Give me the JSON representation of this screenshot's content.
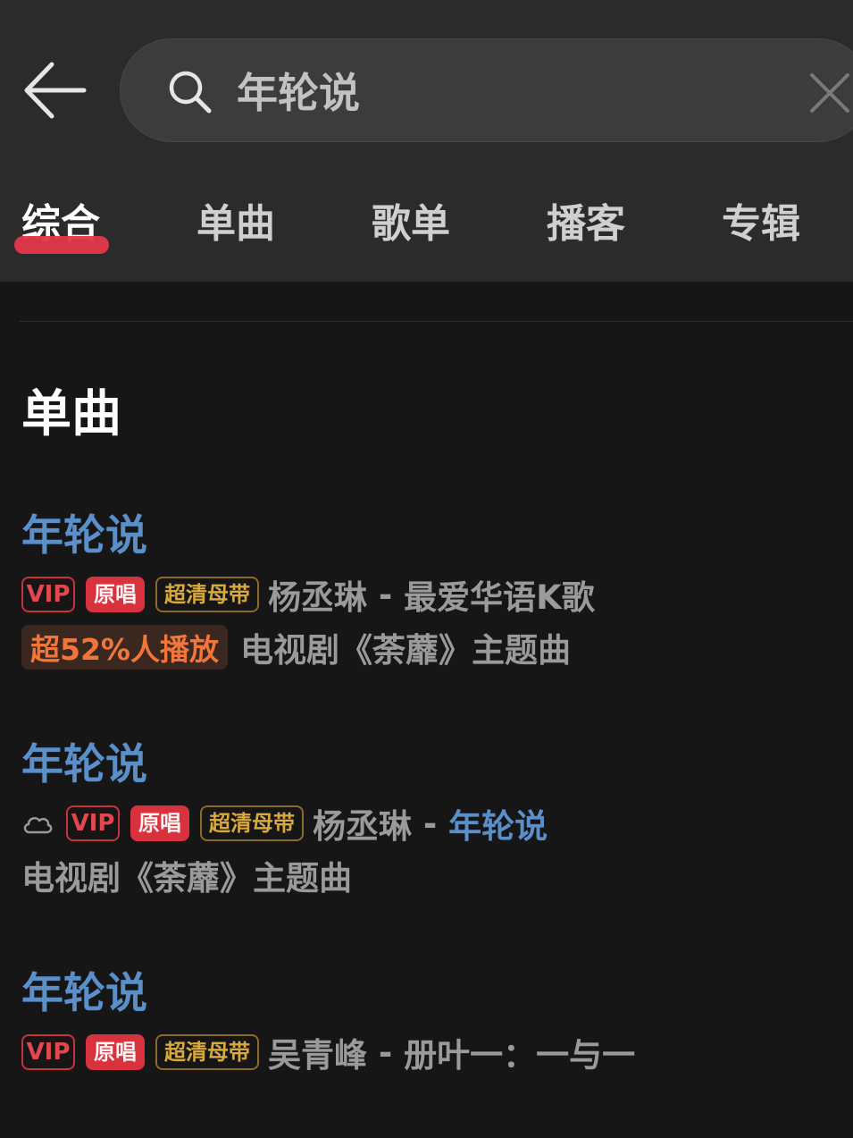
{
  "search": {
    "query": "年轮说"
  },
  "tabs": [
    {
      "label": "综合",
      "active": true
    },
    {
      "label": "单曲",
      "active": false
    },
    {
      "label": "歌单",
      "active": false
    },
    {
      "label": "播客",
      "active": false
    },
    {
      "label": "专辑",
      "active": false
    }
  ],
  "section": {
    "title": "单曲"
  },
  "songs": [
    {
      "title": "年轮说",
      "badges": {
        "vip": "VIP",
        "original": "原唱",
        "hq": "超清母带"
      },
      "artist": "杨丞琳",
      "separator": " - ",
      "album": "最爱华语K歌",
      "hot_badge": "超52%人播放",
      "description": "电视剧《荼蘼》主题曲"
    },
    {
      "title": "年轮说",
      "icon": "cloud-icon",
      "badges": {
        "vip": "VIP",
        "original": "原唱",
        "hq": "超清母带"
      },
      "artist": "杨丞琳",
      "separator": " - ",
      "album": "年轮说",
      "description": "电视剧《荼蘼》主题曲"
    },
    {
      "title": "年轮说",
      "badges": {
        "vip": "VIP",
        "original": "原唱",
        "hq": "超清母带"
      },
      "artist": "吴青峰",
      "separator": " - ",
      "album": "册叶一：一与一"
    }
  ],
  "colors": {
    "header_bg": "#2b2b2b",
    "page_bg": "#161616",
    "accent_red": "#e5364a",
    "link_blue": "#5b8fc9",
    "hq_gold": "#d9a93a",
    "hot_orange": "#f2763a"
  },
  "icons": [
    "back-arrow-icon",
    "search-icon",
    "clear-icon",
    "cloud-icon"
  ]
}
